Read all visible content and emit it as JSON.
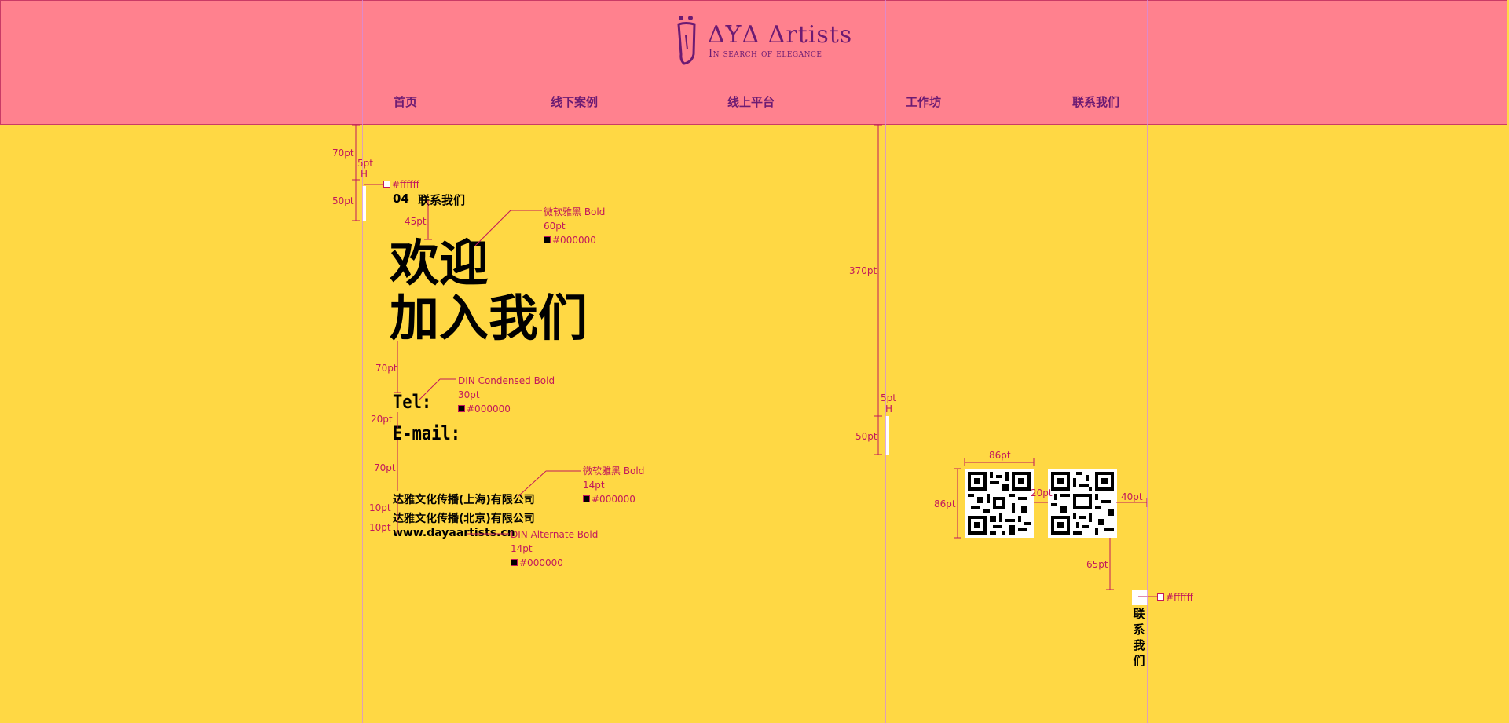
{
  "brand": {
    "name": "ΔYΔ Δrtists",
    "tagline": "In search of elegance"
  },
  "nav": {
    "items": [
      {
        "label": "首页"
      },
      {
        "label": "线下案例"
      },
      {
        "label": "线上平台"
      },
      {
        "label": "工作坊"
      },
      {
        "label": "联系我们"
      }
    ]
  },
  "section": {
    "number": "04",
    "title": "联系我们"
  },
  "headline": {
    "line1": "欢迎",
    "line2": "加入我们"
  },
  "contact": {
    "tel_label": "Tel:",
    "email_label": "E-mail:"
  },
  "companies": [
    "达雅文化传播(上海)有限公司",
    "达雅文化传播(北京)有限公司"
  ],
  "website": "www.dayaartists.cn",
  "side_tab": {
    "label": "联系我们"
  },
  "annotations": {
    "white_1": "#ffffff",
    "white_2": "#ffffff",
    "headline_font": "微软雅黑 Bold",
    "headline_size": "60pt",
    "headline_color": "#000000",
    "contact_font": "DIN Condensed Bold",
    "contact_size": "30pt",
    "contact_color": "#000000",
    "company_font": "微软雅黑 Bold",
    "company_size": "14pt",
    "company_color": "#000000",
    "website_font": "DIN Alternate Bold",
    "website_size": "14pt",
    "website_color": "#000000",
    "m_70a": "70pt",
    "m_5a": "5pt",
    "m_h_a": "H",
    "m_50a": "50pt",
    "m_45": "45pt",
    "m_70b": "70pt",
    "m_20a": "20pt",
    "m_70c": "70pt",
    "m_10a": "10pt",
    "m_10b": "10pt",
    "m_370": "370pt",
    "m_5b": "5pt",
    "m_h_b": "H",
    "m_50b": "50pt",
    "m_86w": "86pt",
    "m_86h": "86pt",
    "m_20b": "20pt",
    "m_40": "40pt",
    "m_65": "65pt"
  },
  "colors": {
    "header_bg": "#ff818e",
    "page_bg": "#ffd844",
    "nav_text": "#6c1b73",
    "annotation": "#c2185b",
    "text": "#000000"
  },
  "icons": {
    "logo": "dya-figure-logo",
    "qr_1": "qr-code-icon",
    "qr_2": "qr-code-icon"
  }
}
